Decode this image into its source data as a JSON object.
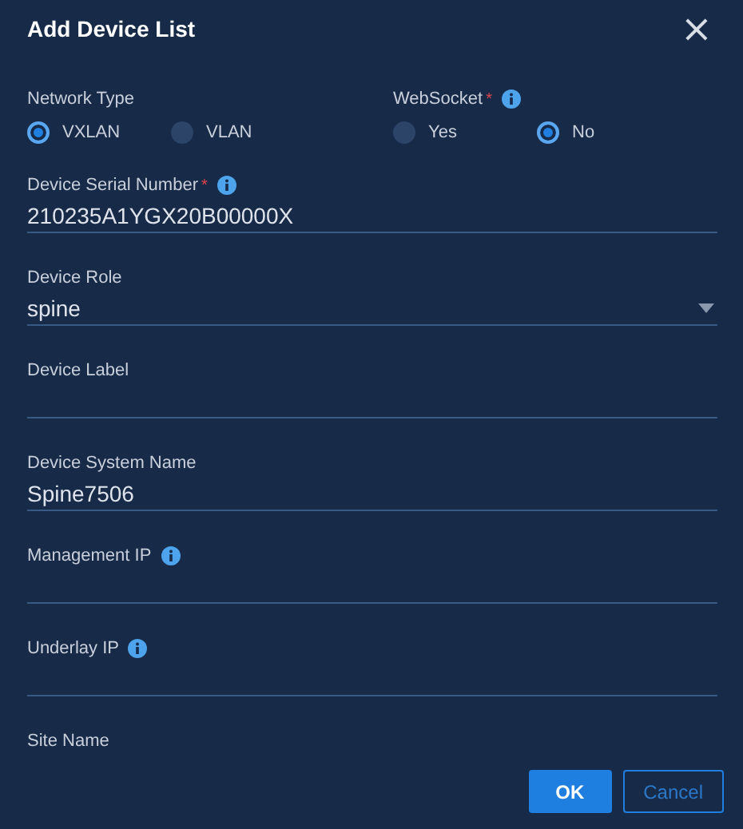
{
  "dialog": {
    "title": "Add Device List",
    "close_icon": "×"
  },
  "radio_groups": [
    {
      "label": "Network Type",
      "info": false,
      "options": [
        {
          "label": "VXLAN",
          "selected": true
        },
        {
          "label": "VLAN",
          "selected": false
        }
      ]
    },
    {
      "label": "WebSocket",
      "required_mark": "*",
      "info": true,
      "options": [
        {
          "label": "Yes",
          "selected": false
        },
        {
          "label": "No",
          "selected": true
        }
      ]
    }
  ],
  "fields": [
    {
      "kind": "text",
      "label": "Device Serial Number",
      "required_mark": "*",
      "info": true,
      "value": "210235A1YGX20B00000X"
    },
    {
      "kind": "select",
      "label": "Device Role",
      "info": false,
      "value": "spine"
    },
    {
      "kind": "text",
      "label": "Device Label",
      "info": false
    },
    {
      "kind": "text",
      "label": "Device System Name",
      "info": false,
      "value": "Spine7506"
    },
    {
      "kind": "text",
      "label": "Management IP",
      "info": true
    },
    {
      "kind": "text",
      "label": "Underlay IP",
      "info": true
    },
    {
      "kind": "label",
      "label": "Site Name",
      "info": false
    }
  ],
  "buttons": [
    {
      "label": "OK",
      "kind": "primary"
    },
    {
      "label": "Cancel",
      "kind": "secondary"
    }
  ]
}
